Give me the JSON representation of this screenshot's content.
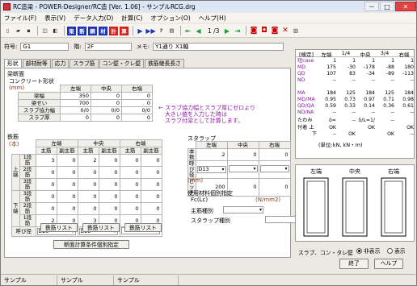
{
  "window": {
    "title": "RC造梁 - POWER-Designer/RC造 [Ver. 1.06] - サンプルRCG.drg",
    "min": "－",
    "max": "□",
    "close": "✕"
  },
  "menu": [
    "ファイル(F)",
    "表示(V)",
    "データ入力(D)",
    "計算(C)",
    "オプション(O)",
    "ヘルプ(H)"
  ],
  "toolbar": {
    "page": "1 /3",
    "b_hari": "梁",
    "b_dan": "断",
    "b_kou": "鋼",
    "b_sai": "材",
    "b_kei": "計",
    "b_zai": "算"
  },
  "header": {
    "fugou_label": "符号:",
    "fugou": "G1",
    "kai_label": "階:",
    "kai": "2F",
    "memo_label": "メモ:",
    "memo": "Y1通り X1軸"
  },
  "tabs": [
    "形状",
    "部材耐等",
    "応力",
    "スラブ筋",
    "コン壁・クレ壁",
    "鉄筋継長長さ"
  ],
  "shape": {
    "section_title": "梁断面",
    "sub_title": "コンクリート形状",
    "unit": "(mm)",
    "cols": [
      "左端",
      "中央",
      "右端"
    ],
    "rows": [
      {
        "label": "梁幅",
        "v": [
          "350",
          "0",
          "0"
        ]
      },
      {
        "label": "梁せい",
        "v": [
          "700",
          "0",
          "0"
        ]
      },
      {
        "label": "スラブ協力幅",
        "v": [
          "0/0",
          "0/0",
          "0/0"
        ]
      },
      {
        "label": "スラブ厚",
        "v": [
          "0",
          "0",
          "0"
        ]
      }
    ],
    "note1": "← スラブ協力幅とスラブ厚にゼロより",
    "note2": "大きい値を入力した時は",
    "note3": "スラブ付梁として計算します。"
  },
  "rebar": {
    "title": "鉄筋",
    "unit": "(本)",
    "groups": [
      "左端",
      "中央",
      "右端"
    ],
    "sub": [
      "主筋",
      "副主筋",
      "主筋",
      "副主筋",
      "主筋",
      "副主筋"
    ],
    "upper_label": "上端",
    "lower_label": "下端",
    "rows": [
      {
        "label": "1段筋",
        "v": [
          "3",
          "0",
          "2",
          "0",
          "0",
          "0"
        ]
      },
      {
        "label": "2段筋",
        "v": [
          "0",
          "0",
          "0",
          "0",
          "0",
          "0"
        ]
      },
      {
        "label": "3段筋",
        "v": [
          "0",
          "0",
          "0",
          "0",
          "0",
          "0"
        ]
      },
      {
        "label": "3段筋",
        "v": [
          "0",
          "0",
          "0",
          "0",
          "0",
          "0"
        ]
      },
      {
        "label": "2段筋",
        "v": [
          "0",
          "0",
          "0",
          "0",
          "0",
          "0"
        ]
      },
      {
        "label": "1段筋",
        "v": [
          "2",
          "0",
          "3",
          "0",
          "0",
          "0"
        ]
      }
    ],
    "yobikei_label": "呼び径",
    "yobikei": [
      "D25",
      "D25",
      ""
    ],
    "list_btn": "鉄筋リスト"
  },
  "stirrup": {
    "title": "スタラップ",
    "cols": [
      "左端",
      "中央",
      "右端"
    ],
    "rows": [
      {
        "label": "本数",
        "v": [
          "2",
          "0",
          "0"
        ]
      },
      {
        "label": "呼び径",
        "v": [
          "D13",
          "",
          ""
        ]
      },
      {
        "label": "ピッチ",
        "v": [
          "200",
          "0",
          "0"
        ]
      }
    ],
    "unit": "(mm)"
  },
  "material": {
    "title": "使用材料個別指定",
    "fc_label": "Fc(Lc)",
    "fc_unit": "(N/mm2)",
    "main_label": "主筋種別",
    "stirrup_label": "スタラップ種別"
  },
  "bottom_btn": "断面計算条件個別指定",
  "result": {
    "hdr": [
      "[検定]",
      "左端",
      "1/4",
      "中央",
      "3/4",
      "右端"
    ],
    "rows": [
      {
        "label": "短case",
        "v": [
          "1",
          "1",
          "1",
          "1",
          "1"
        ]
      },
      {
        "label": "MD",
        "v": [
          "175",
          "-30",
          "-178",
          "-88",
          "180"
        ]
      },
      {
        "label": "QD",
        "v": [
          "107",
          "83",
          "-34",
          "-89",
          "-113"
        ]
      },
      {
        "label": "ND",
        "v": [
          "--",
          "--",
          "--",
          "--",
          "--"
        ]
      },
      {
        "label": "",
        "v": [
          "",
          "",
          "",
          "",
          ""
        ]
      },
      {
        "label": "MA",
        "v": [
          "184",
          "125",
          "184",
          "125",
          "184"
        ]
      },
      {
        "label": "MD/MA",
        "v": [
          "0.95",
          "0.73",
          "0.97",
          "0.71",
          "0.98"
        ]
      },
      {
        "label": "QD/QA",
        "v": [
          "0.59",
          "0.33",
          "0.14",
          "0.36",
          "0.61"
        ]
      },
      {
        "label": "ND/NA",
        "v": [
          "--",
          "--",
          "--",
          "--",
          "--"
        ]
      },
      {
        "label": "たわみ",
        "v": [
          "δ=",
          "--",
          "δ/L=1/",
          "--",
          ""
        ]
      },
      {
        "label": "付着 上",
        "v": [
          "OK",
          "",
          "OK",
          "",
          "OK"
        ]
      },
      {
        "label": "下",
        "v": [
          "--",
          "OK",
          "",
          "OK",
          "--"
        ]
      }
    ],
    "unit": "(単位:kN, kN・m)"
  },
  "section_view": {
    "cols": [
      "左端",
      "中央",
      "右端"
    ]
  },
  "radio": {
    "label": "スラブ、コン・タレ壁",
    "opt1": "非表示",
    "opt2": "表示"
  },
  "actions": {
    "ok": "終了",
    "help": "ヘルプ"
  },
  "status": [
    "サンプル",
    "サンプル",
    "サンプル"
  ],
  "colors": {
    "accent_red": "#d52020",
    "accent_blue": "#1a32b8",
    "note_purple": "#8b1aa0",
    "label_brown": "#8b3a1a"
  }
}
